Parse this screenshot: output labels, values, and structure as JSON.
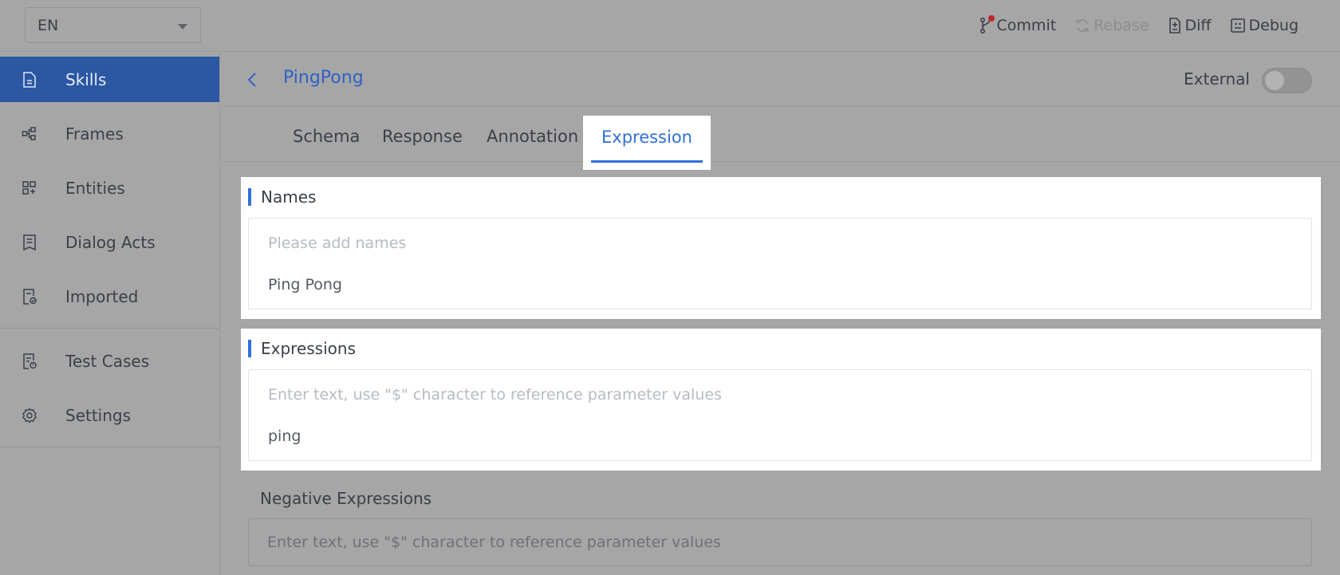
{
  "language": {
    "selected": "EN"
  },
  "toolbar": {
    "commit": "Commit",
    "rebase": "Rebase",
    "diff": "Diff",
    "debug": "Debug"
  },
  "sidebar": {
    "items": [
      {
        "label": "Skills",
        "icon": "document-icon",
        "active": true
      },
      {
        "label": "Frames",
        "icon": "frames-icon"
      },
      {
        "label": "Entities",
        "icon": "entities-icon"
      },
      {
        "label": "Dialog Acts",
        "icon": "dialog-acts-icon"
      },
      {
        "label": "Imported",
        "icon": "imported-icon"
      },
      {
        "label": "Test Cases",
        "icon": "test-cases-icon"
      },
      {
        "label": "Settings",
        "icon": "gear-icon"
      }
    ]
  },
  "header": {
    "title": "PingPong",
    "external_label": "External",
    "external_on": false
  },
  "tabs": {
    "items": [
      "Schema",
      "Response",
      "Annotation",
      "Expression"
    ],
    "active": "Expression"
  },
  "names": {
    "heading": "Names",
    "placeholder": "Please add names",
    "values": [
      "Ping Pong"
    ]
  },
  "expressions": {
    "heading": "Expressions",
    "placeholder": "Enter text, use \"$\" character to reference parameter values",
    "values": [
      "ping"
    ]
  },
  "negative_expressions": {
    "heading": "Negative Expressions",
    "placeholder": "Enter text, use \"$\" character to reference parameter values"
  },
  "colors": {
    "accent": "#2f6fdc",
    "sidebar_active": "#2b57a3",
    "overlay": "#a6a6a6",
    "commit_dot": "#c0262a"
  }
}
